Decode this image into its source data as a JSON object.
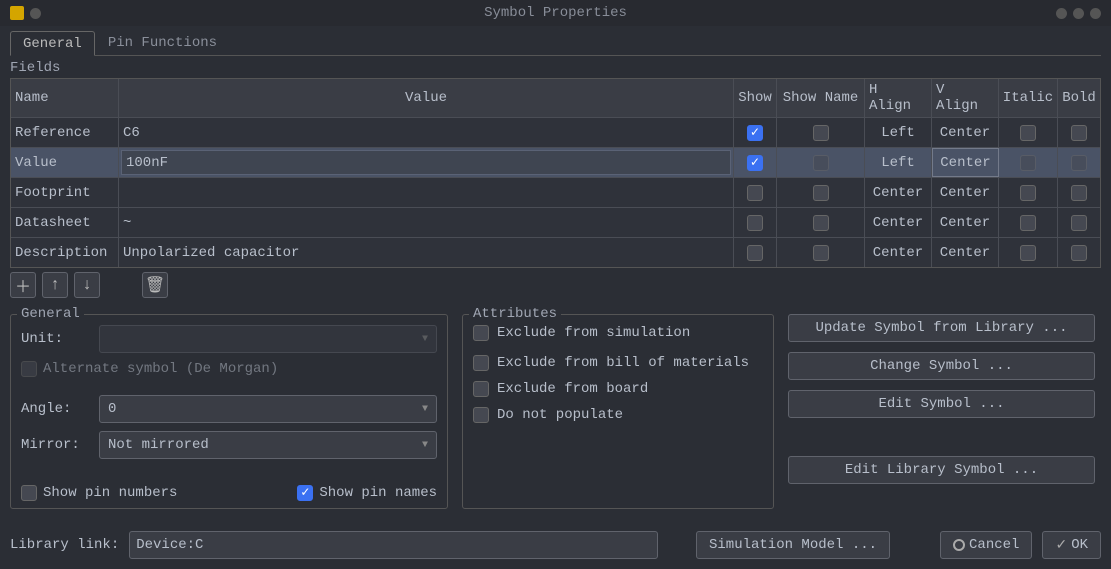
{
  "window": {
    "title": "Symbol Properties"
  },
  "tabs": {
    "general": "General",
    "pinfuncs": "Pin Functions"
  },
  "fields": {
    "group_label": "Fields",
    "headers": {
      "name": "Name",
      "value": "Value",
      "show": "Show",
      "showname": "Show Name",
      "halign": "H Align",
      "valign": "V Align",
      "italic": "Italic",
      "bold": "Bold"
    },
    "rows": [
      {
        "name": "Reference",
        "value": "C6",
        "show": true,
        "showname": false,
        "halign": "Left",
        "valign": "Center",
        "italic": false,
        "bold": false,
        "selected": false
      },
      {
        "name": "Value",
        "value": "100nF",
        "show": true,
        "showname": false,
        "halign": "Left",
        "valign": "Center",
        "italic": false,
        "bold": false,
        "selected": true
      },
      {
        "name": "Footprint",
        "value": "",
        "show": false,
        "showname": false,
        "halign": "Center",
        "valign": "Center",
        "italic": false,
        "bold": false,
        "selected": false
      },
      {
        "name": "Datasheet",
        "value": "~",
        "show": false,
        "showname": false,
        "halign": "Center",
        "valign": "Center",
        "italic": false,
        "bold": false,
        "selected": false
      },
      {
        "name": "Description",
        "value": "Unpolarized capacitor",
        "show": false,
        "showname": false,
        "halign": "Center",
        "valign": "Center",
        "italic": false,
        "bold": false,
        "selected": false
      }
    ]
  },
  "general": {
    "title": "General",
    "unit_label": "Unit:",
    "alt_symbol": "Alternate symbol (De Morgan)",
    "angle_label": "Angle:",
    "angle_value": "0",
    "mirror_label": "Mirror:",
    "mirror_value": "Not mirrored",
    "show_pin_numbers": "Show pin numbers",
    "show_pin_names": "Show pin names"
  },
  "attributes": {
    "title": "Attributes",
    "exclude_sim": "Exclude from simulation",
    "exclude_bom": "Exclude from bill of materials",
    "exclude_board": "Exclude from board",
    "dnp": "Do not populate"
  },
  "buttons": {
    "update": "Update Symbol from Library ...",
    "change": "Change Symbol ...",
    "edit": "Edit Symbol ...",
    "edit_lib": "Edit Library Symbol ..."
  },
  "bottom": {
    "lib_label": "Library link:",
    "lib_value": "Device:C",
    "sim": "Simulation Model ...",
    "cancel": "Cancel",
    "ok": "OK"
  }
}
